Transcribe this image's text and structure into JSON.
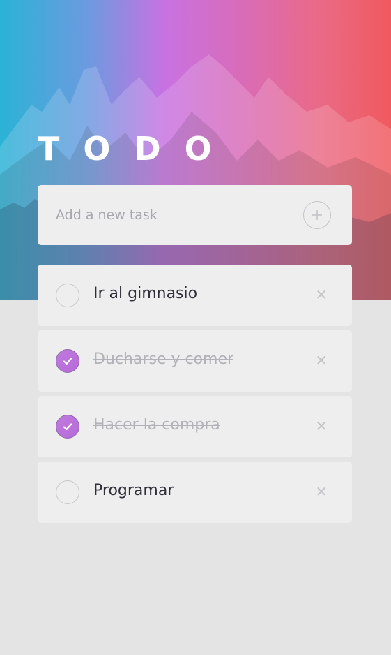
{
  "app": {
    "title": "TODO"
  },
  "new_task": {
    "placeholder": "Add a new task"
  },
  "tasks": [
    {
      "label": "Ir al gimnasio",
      "completed": false
    },
    {
      "label": "Ducharse y comer",
      "completed": true
    },
    {
      "label": "Hacer la compra",
      "completed": true
    },
    {
      "label": "Programar",
      "completed": false
    }
  ],
  "colors": {
    "accent": "#b86ddb",
    "background": "#e4e4e4",
    "card": "#eeeeee"
  },
  "icons": {
    "add": "plus-circle-icon",
    "check": "checkmark-icon",
    "delete": "close-icon"
  }
}
